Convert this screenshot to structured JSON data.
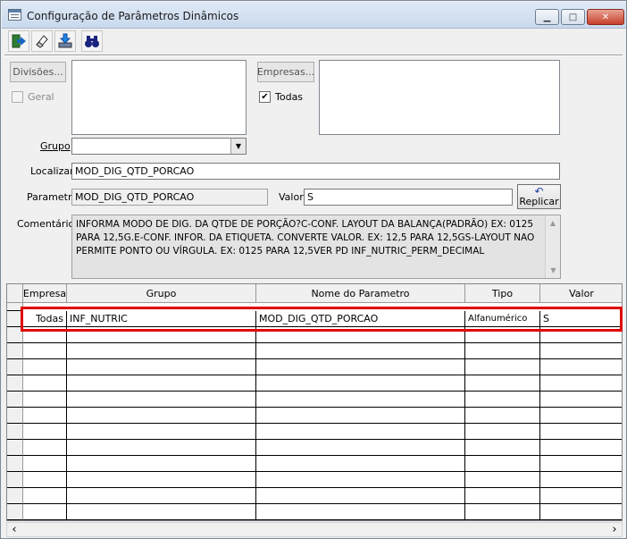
{
  "window": {
    "title": "Configuração de Parâmetros Dinâmicos",
    "min_glyph": "▁",
    "max_glyph": "□",
    "close_glyph": "✕"
  },
  "toolbar": {
    "exit_icon": "exit-door-icon",
    "clear_icon": "eraser-icon",
    "save_icon": "save-download-icon",
    "search_icon": "binoculars-icon",
    "exit_glyph": "⇤",
    "clear_glyph": "✎",
    "save_glyph": "⤓",
    "search_glyph": "⚲"
  },
  "filters": {
    "divisoes_label": "Divisões...",
    "geral_label": "Geral",
    "empresas_label": "Empresas...",
    "todas_label": "Todas",
    "todas_checked": true,
    "check_glyph": "✔",
    "grupo_label": "Grupo",
    "grupo_value": "",
    "localizar_label": "Localizar",
    "localizar_value": "MOD_DIG_QTD_PORCAO",
    "parametro_label": "Parametro",
    "parametro_value": "MOD_DIG_QTD_PORCAO",
    "valor_label": "Valor",
    "valor_value": "S",
    "replicar_label": "Replicar",
    "replicar_glyph": "↶",
    "comentarios_label": "Comentários",
    "comentarios_value": "INFORMA MODO DE DIG. DA QTDE DE PORÇÃO?C-CONF. LAYOUT DA BALANÇA(PADRÃO) EX: 0125 PARA 12,5G.E-CONF. INFOR. DA ETIQUETA. CONVERTE VALOR. EX: 12,5 PARA 12,5GS-LAYOUT NAO PERMITE PONTO OU VÍRGULA. EX: 0125 PARA 12,5VER PD INF_NUTRIC_PERM_DECIMAL"
  },
  "grid": {
    "columns": [
      "Empresa",
      "Grupo",
      "Nome do Parametro",
      "Tipo",
      "Valor"
    ],
    "rows": [
      {
        "empresa": "Todas",
        "grupo": "INF_NUTRIC",
        "nome": "MOD_DIG_QTD_PORCAO",
        "tipo": "Alfanumérico",
        "valor": "S"
      }
    ],
    "highlight_color": "#e00000"
  },
  "scrollbar": {
    "left_glyph": "‹",
    "right_glyph": "›"
  }
}
